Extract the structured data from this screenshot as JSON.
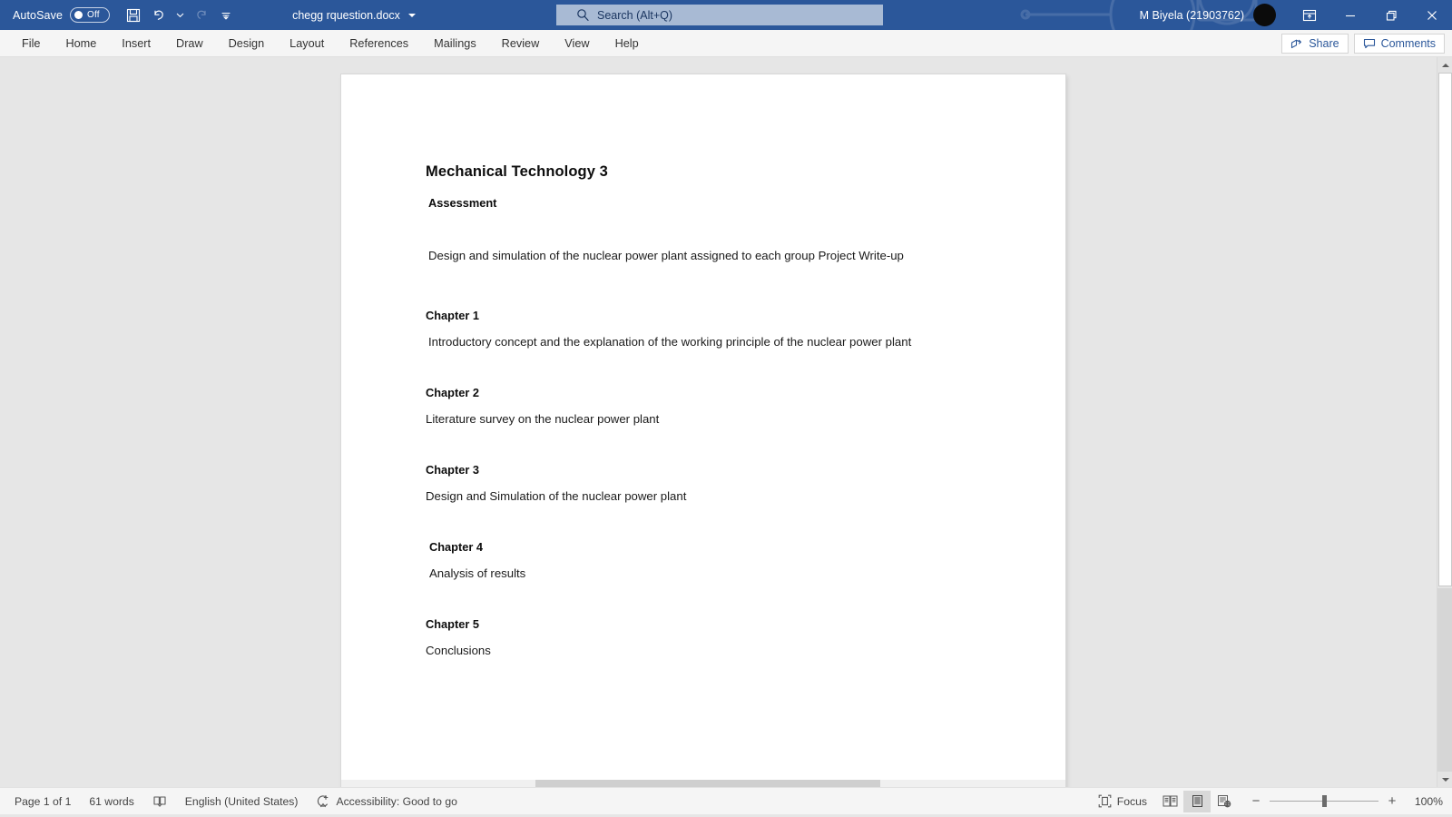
{
  "titlebar": {
    "autosave_label": "AutoSave",
    "autosave_state": "Off",
    "document_title": "chegg rquestion.docx",
    "account_name": "M Biyela (21903762)",
    "quick_access": [
      {
        "name": "save-icon",
        "tooltip": "Save"
      },
      {
        "name": "undo-icon",
        "tooltip": "Undo"
      },
      {
        "name": "redo-icon",
        "tooltip": "Redo"
      },
      {
        "name": "customize-quick-access-toolbar-icon",
        "tooltip": "Customize Quick Access Toolbar"
      }
    ],
    "window_controls": [
      "ribbon-display-options",
      "minimize",
      "restore",
      "close"
    ]
  },
  "search": {
    "placeholder": "Search (Alt+Q)",
    "icon": "search-icon"
  },
  "ribbon": {
    "tabs": [
      {
        "label": "File"
      },
      {
        "label": "Home"
      },
      {
        "label": "Insert"
      },
      {
        "label": "Draw"
      },
      {
        "label": "Design"
      },
      {
        "label": "Layout"
      },
      {
        "label": "References"
      },
      {
        "label": "Mailings"
      },
      {
        "label": "Review"
      },
      {
        "label": "View"
      },
      {
        "label": "Help"
      }
    ],
    "share_label": "Share",
    "comments_label": "Comments",
    "accent_color": "#2b579a"
  },
  "document": {
    "title": "Mechanical Technology 3",
    "subtitle": "Assessment",
    "intro": "Design and simulation of the nuclear power plant assigned to each group Project Write-up",
    "sections": [
      {
        "heading": "Chapter 1",
        "body": "Introductory concept and the explanation of the working principle of the nuclear power plant"
      },
      {
        "heading": "Chapter 2",
        "body": "Literature survey on the nuclear power plant"
      },
      {
        "heading": "Chapter 3",
        "body": "Design and Simulation of the nuclear power plant"
      },
      {
        "heading": "Chapter 4",
        "body": "Analysis of results"
      },
      {
        "heading": "Chapter 5",
        "body": "Conclusions"
      }
    ]
  },
  "statusbar": {
    "page_info": "Page 1 of 1",
    "word_count": "61 words",
    "proofing_icon": "proofing-errors-icon",
    "language": "English (United States)",
    "accessibility_icon": "accessibility-icon",
    "accessibility": "Accessibility: Good to go",
    "focus_label": "Focus",
    "focus_icon": "focus-mode-icon",
    "views": [
      {
        "name": "read-mode-view-button",
        "active": false
      },
      {
        "name": "print-layout-view-button",
        "active": true
      },
      {
        "name": "web-layout-view-button",
        "active": false
      }
    ],
    "zoom_out": "−",
    "zoom_in": "+",
    "zoom_level": "100%"
  }
}
